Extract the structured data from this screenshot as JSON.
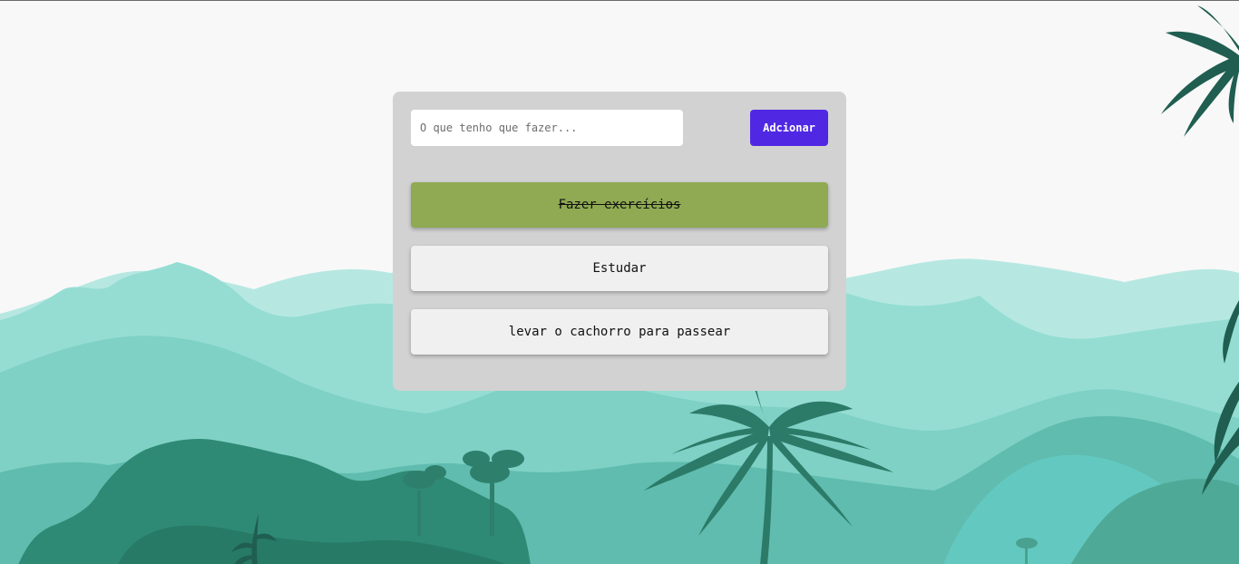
{
  "form": {
    "input_placeholder": "O que tenho que fazer...",
    "input_value": "",
    "add_label": "Adcionar"
  },
  "tasks": [
    {
      "label": "Fazer exercícios",
      "done": true
    },
    {
      "label": "Estudar",
      "done": false
    },
    {
      "label": "levar o cachorro para passear",
      "done": false
    }
  ],
  "colors": {
    "add_button": "#5028e4",
    "done_task": "#8faa52",
    "task": "#f0f0f0",
    "card": "#d2d2d2"
  }
}
